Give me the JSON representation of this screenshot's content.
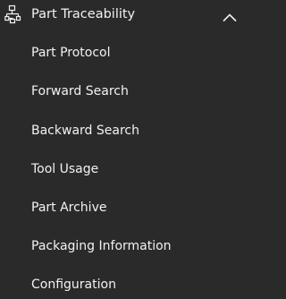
{
  "menu": {
    "header": {
      "label": "Part Traceability",
      "icon": "traceability-tree-icon",
      "state_icon": "chevron-up-icon",
      "expanded": true
    },
    "items": [
      {
        "label": "Part Protocol"
      },
      {
        "label": "Forward Search"
      },
      {
        "label": "Backward Search"
      },
      {
        "label": "Tool Usage"
      },
      {
        "label": "Part Archive"
      },
      {
        "label": "Packaging Information"
      },
      {
        "label": "Configuration"
      }
    ]
  },
  "colors": {
    "background": "#2a2a2a",
    "text": "#f2f2f2"
  }
}
